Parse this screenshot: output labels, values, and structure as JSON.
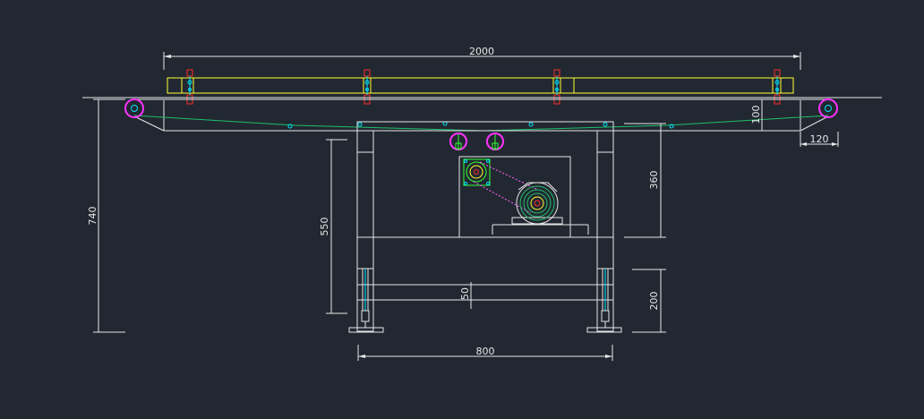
{
  "colors": {
    "background": "#222831",
    "line": "#e6e6e6",
    "frame_yellow": "#ffff33",
    "belt_green": "#1fbf6a",
    "pulley_magenta": "#ff33ff",
    "pulley_cyan": "#00e5ff",
    "bolt_red": "#ff2a2a",
    "drive_green": "#33ff33",
    "chain_magenta": "#ff66ff"
  },
  "dimensions": {
    "overall_length": "2000",
    "pulley_drop": "100",
    "pulley_overhang": "120",
    "total_height": "740",
    "leg_height": "550",
    "motor_frame_height": "360",
    "crossbar_gap": "50",
    "foot_height": "200",
    "leg_spacing": "800"
  }
}
